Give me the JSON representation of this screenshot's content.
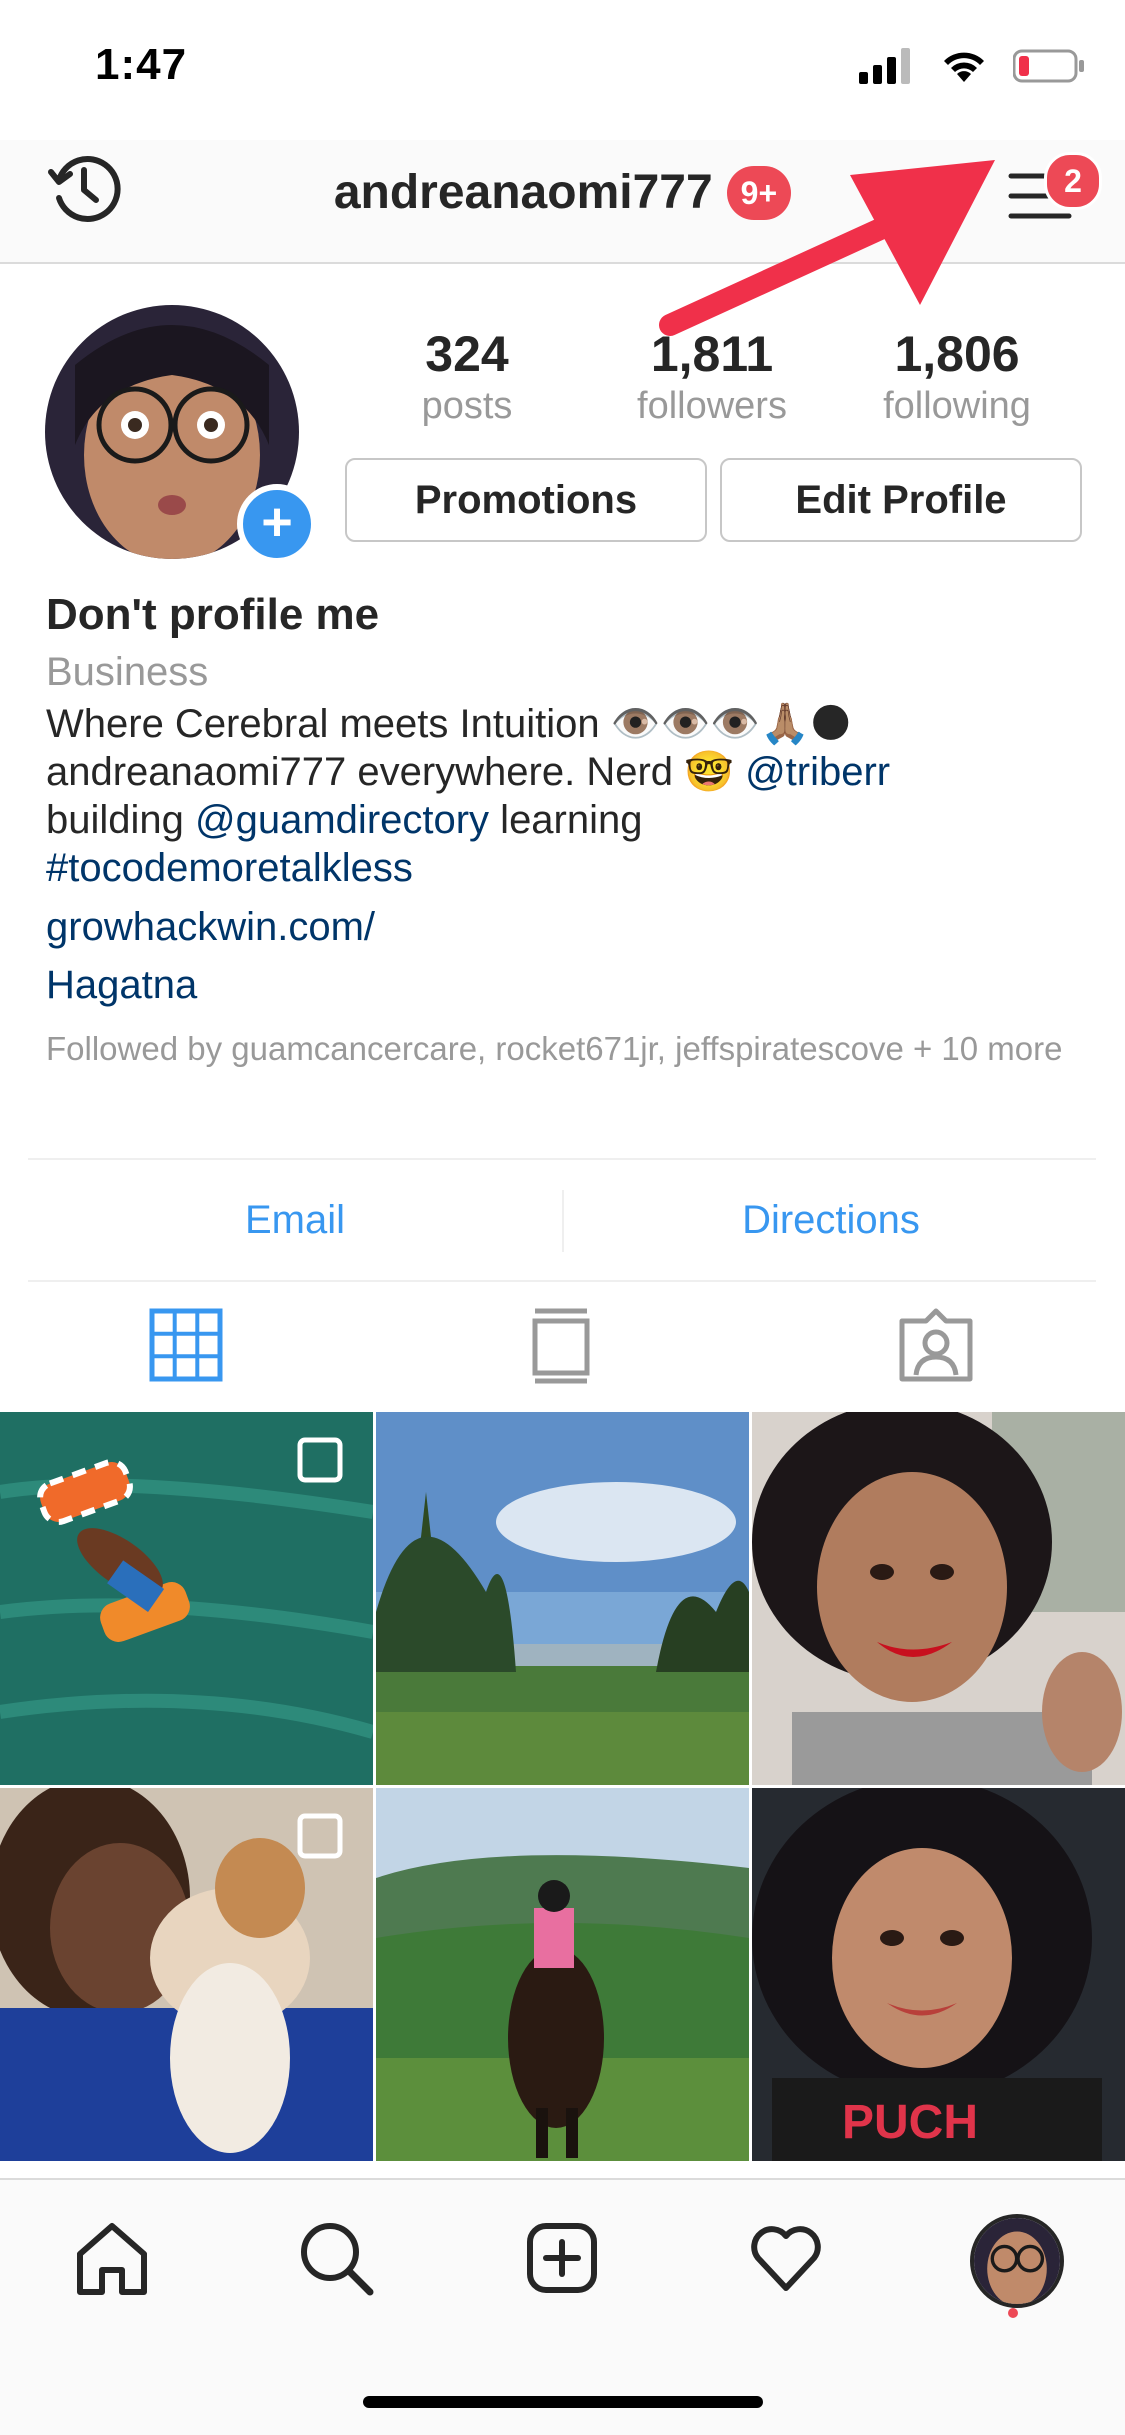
{
  "status": {
    "time": "1:47"
  },
  "header": {
    "username": "andreanaomi777",
    "notif_count": "9+",
    "menu_badge": "2"
  },
  "stats": [
    {
      "value": "324",
      "label": "posts"
    },
    {
      "value": "1,811",
      "label": "followers"
    },
    {
      "value": "1,806",
      "label": "following"
    }
  ],
  "buttons": {
    "promotions": "Promotions",
    "edit_profile": "Edit Profile"
  },
  "bio": {
    "name": "Don't profile me",
    "category": "Business",
    "line1": "Where Cerebral meets Intuition 👁️👁️👁️🙏🏽🌑",
    "line2_a": "andreanaomi777 everywhere. Nerd 🤓 ",
    "line2_mention": "@triberr",
    "line3_a": "building ",
    "line3_mention": "@guamdirectory",
    "line3_b": " learning",
    "hashtag": "#tocodemoretalkless",
    "website": "growhackwin.com/",
    "location": "Hagatna",
    "followed_by": "Followed by guamcancercare, rocket671jr, jeffspiratescove + 10 more"
  },
  "contact": {
    "email": "Email",
    "directions": "Directions"
  },
  "colors": {
    "accent": "#3897f0",
    "badge": "#ed4956",
    "link": "#003569",
    "arrow": "#f0304a"
  }
}
